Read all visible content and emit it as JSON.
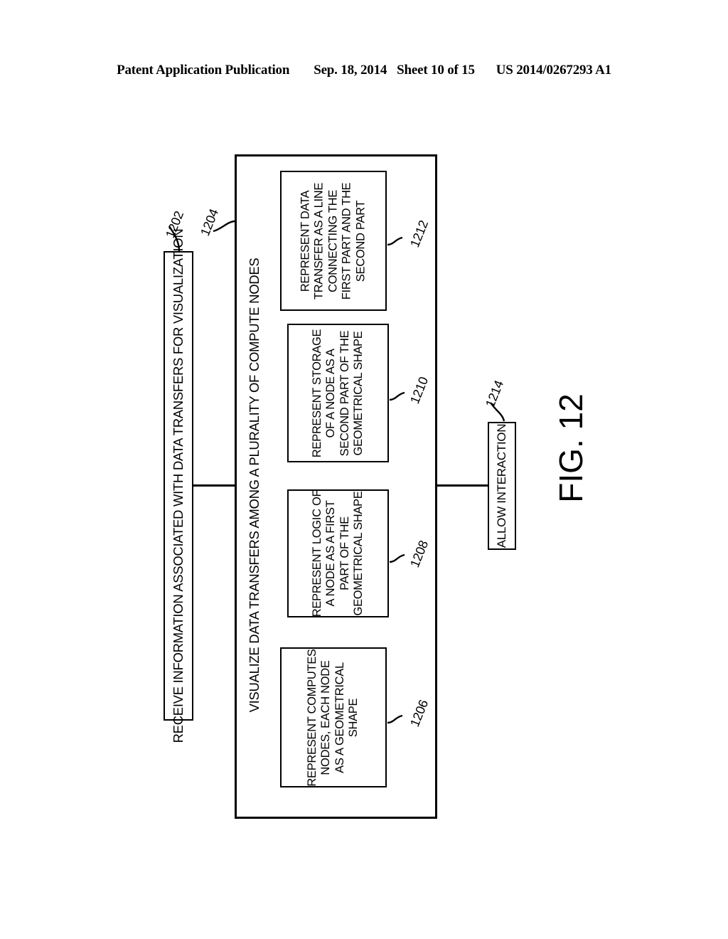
{
  "header": {
    "publication": "Patent Application Publication",
    "date": "Sep. 18, 2014",
    "sheet": "Sheet 10 of 15",
    "patent_number": "US 2014/0267293 A1"
  },
  "figure": {
    "caption": "FIG. 12"
  },
  "flowchart": {
    "boxes": [
      {
        "ref": "1202",
        "text": "RECEIVE INFORMATION ASSOCIATED WITH DATA TRANSFERS FOR VISUALIZATION"
      },
      {
        "ref": "1204",
        "text": "VISUALIZE DATA TRANSFERS AMONG A PLURALITY OF COMPUTE NODES"
      },
      {
        "ref": "1206",
        "text": "REPRESENT COMPUTES\nNODES, EACH NODE\nAS A GEOMETRICAL\nSHAPE"
      },
      {
        "ref": "1208",
        "text": "REPRESENT LOGIC OF\nA NODE AS A FIRST\nPART OF THE\nGEOMETRICAL SHAPE"
      },
      {
        "ref": "1210",
        "text": "REPRESENT STORAGE\nOF A NODE AS A\nSECOND PART OF THE\nGEOMETRICAL SHAPE"
      },
      {
        "ref": "1212",
        "text": "REPRESENT DATA\nTRANSFER AS A LINE\nCONNECTING THE\nFIRST PART AND THE\nSECOND PART"
      },
      {
        "ref": "1214",
        "text": "ALLOW INTERACTION"
      }
    ]
  }
}
